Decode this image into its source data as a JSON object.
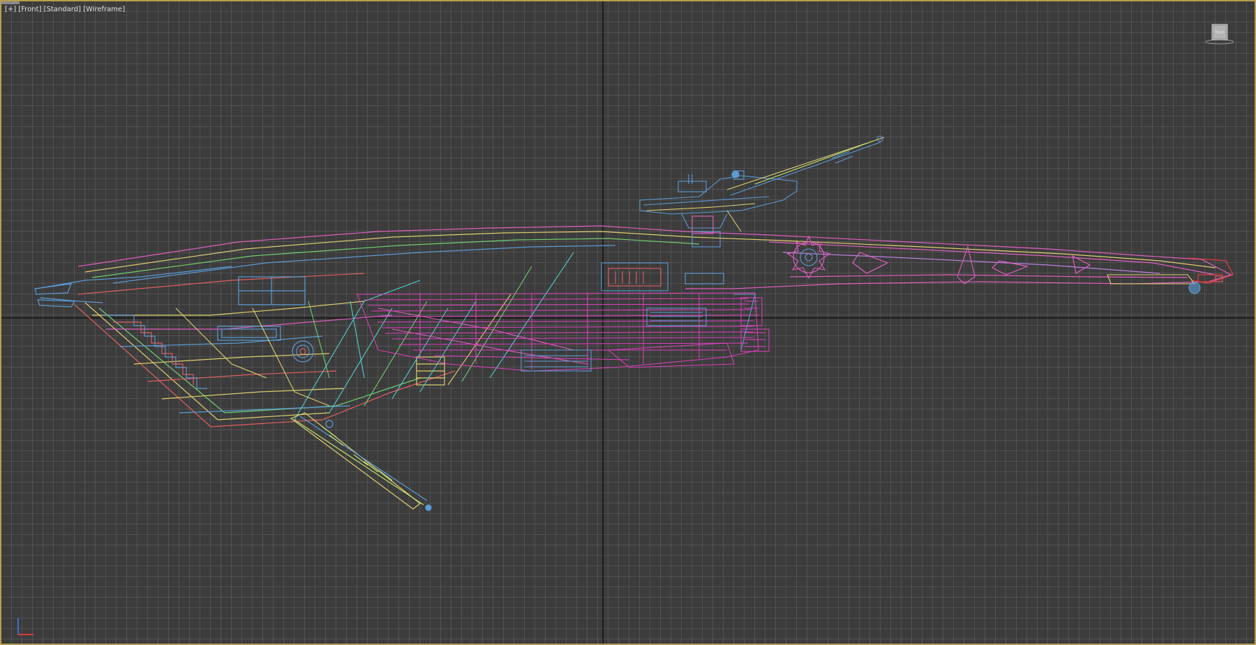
{
  "viewport": {
    "labels": [
      "[+]",
      "[Front]",
      "[Standard]",
      "[Wireframe]"
    ],
    "view_name": "Front",
    "shading_mode": "Wireframe"
  },
  "viewcube": {
    "face_label": "Front"
  },
  "colors": {
    "background": "#3c3c3c",
    "grid": "#5a5a5a",
    "frame": "#b8a04a",
    "world_axis": "#111111",
    "wire_palette": [
      "#5b9bd5",
      "#e06060",
      "#e0d070",
      "#e040c0",
      "#50d0d0",
      "#70d070",
      "#c0e070"
    ]
  },
  "icons": [
    "viewcube-icon",
    "axis-gizmo-icon"
  ]
}
